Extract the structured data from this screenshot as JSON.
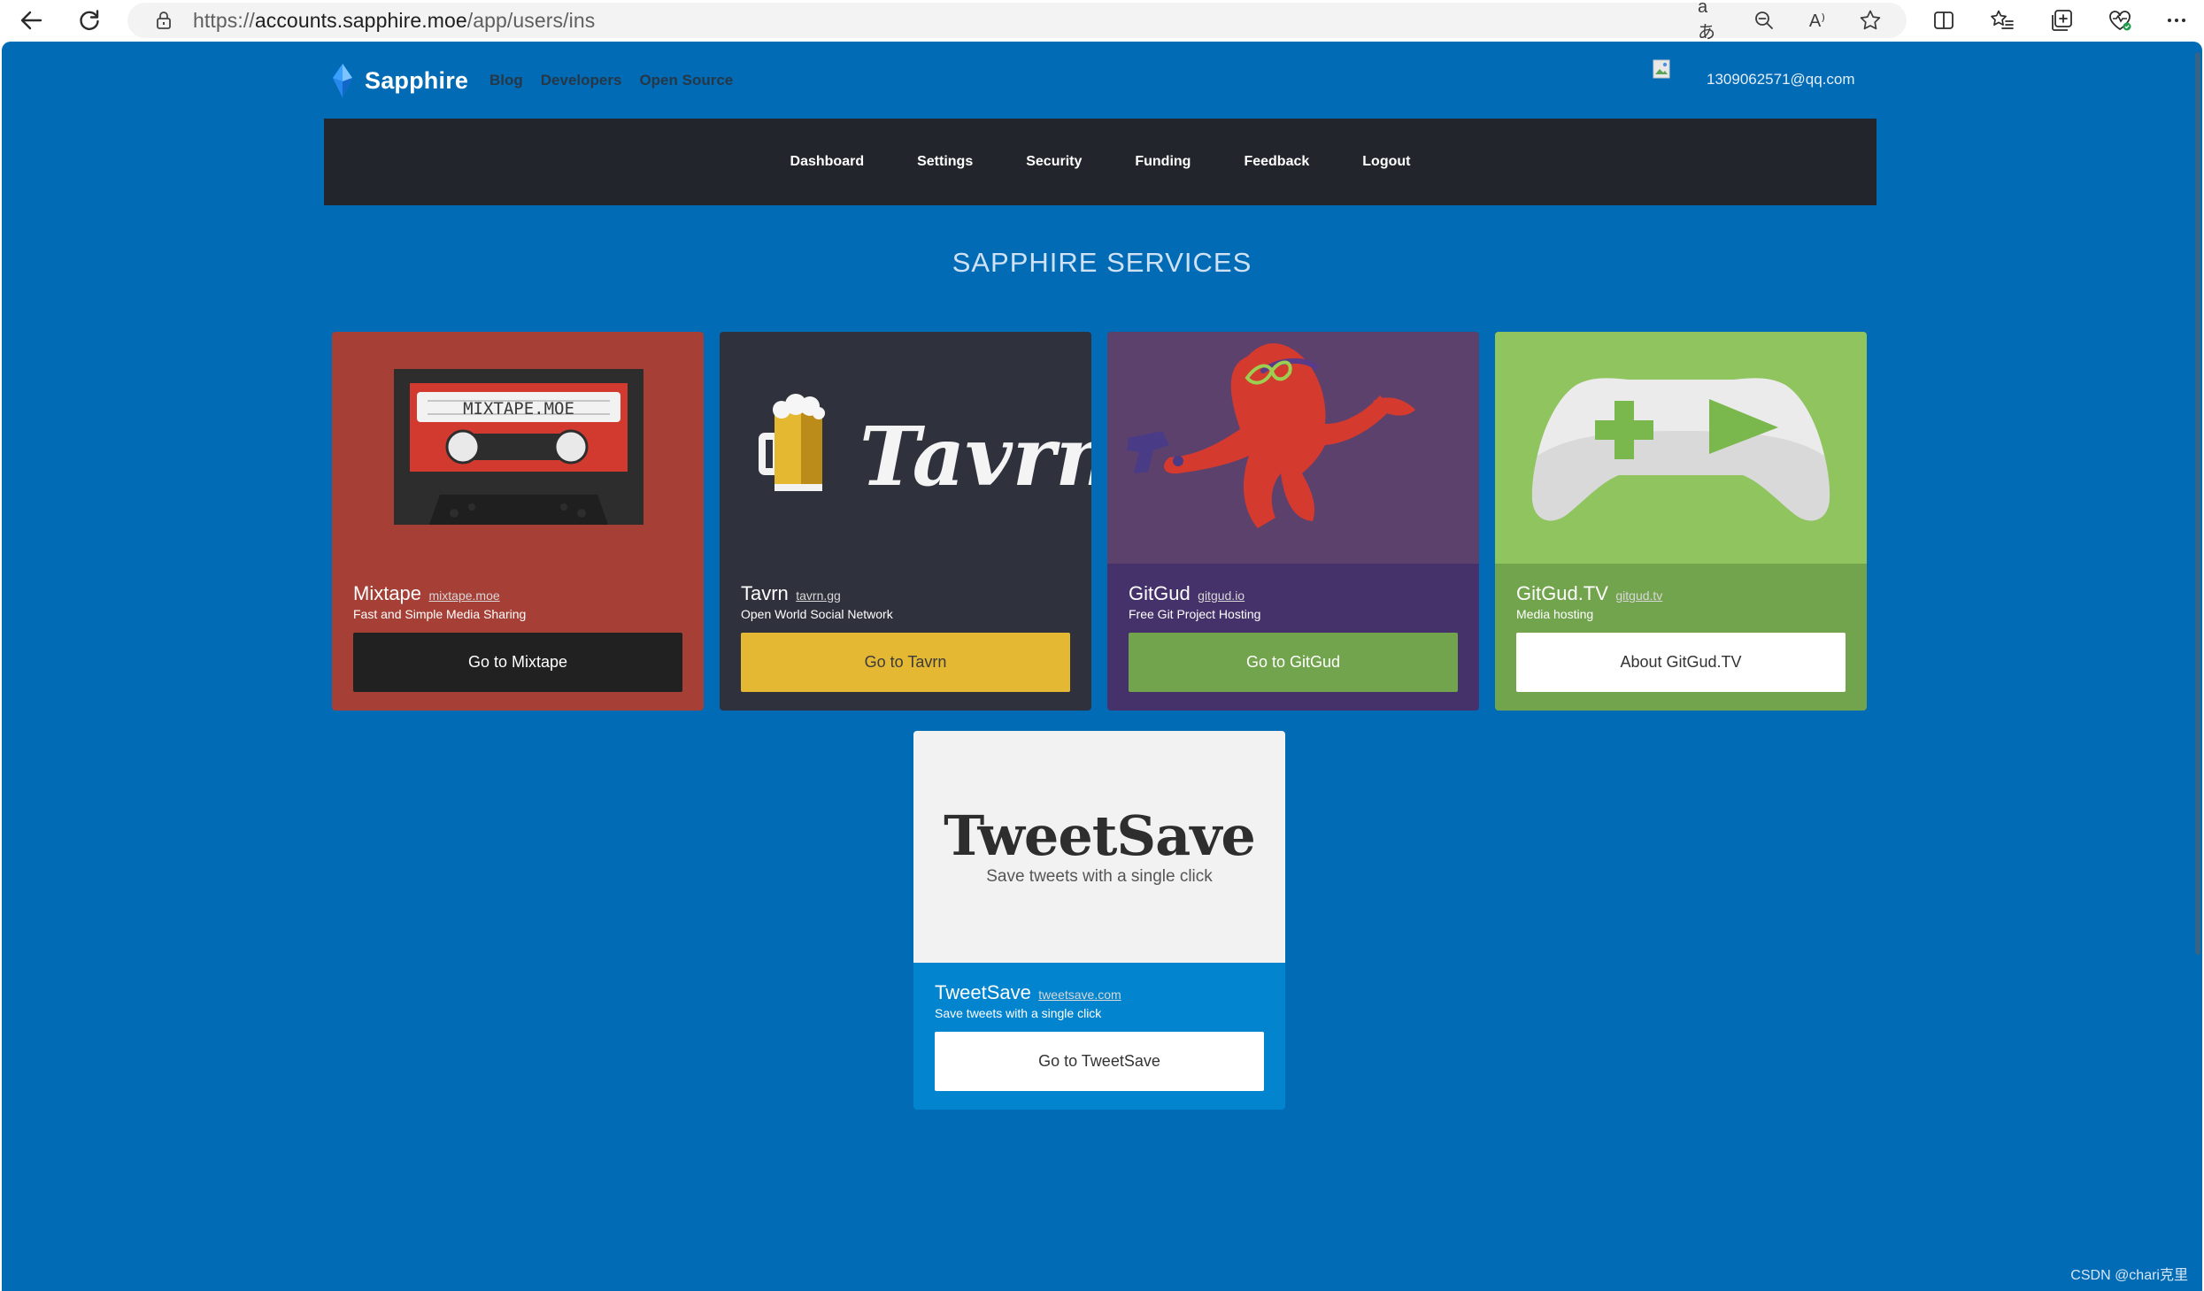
{
  "browser": {
    "url_scheme": "https://",
    "url_host": "accounts.sapphire.moe",
    "url_path": "/app/users/ins",
    "reader_icon": "aあ",
    "read_aloud_icon": "A⁾"
  },
  "site": {
    "brand_name": "Sapphire",
    "top_links": [
      "Blog",
      "Developers",
      "Open Source"
    ],
    "user_email": "1309062571@qq.com"
  },
  "dashboard_nav": [
    "Dashboard",
    "Settings",
    "Security",
    "Funding",
    "Feedback",
    "Logout"
  ],
  "section_title": "SAPPHIRE SERVICES",
  "services": [
    {
      "name": "Mixtape",
      "domain": "mixtape.moe",
      "description": "Fast and Simple Media Sharing",
      "button": "Go to Mixtape",
      "art_text": "MIXTAPE.MOE",
      "colors": {
        "card": "#a63f35",
        "button": "#212121",
        "button_text": "#ffffff"
      }
    },
    {
      "name": "Tavrn",
      "domain": "tavrn.gg",
      "description": "Open World Social Network",
      "button": "Go to Tavrn",
      "art_text": "Tavrn",
      "colors": {
        "card": "#2f323d",
        "button": "#e5b833",
        "button_text": "#3b3b3b"
      }
    },
    {
      "name": "GitGud",
      "domain": "gitgud.io",
      "description": "Free Git Project Hosting",
      "button": "Go to GitGud",
      "colors": {
        "card": "#46326a",
        "button": "#72a44e",
        "button_text": "#ffffff"
      }
    },
    {
      "name": "GitGud.TV",
      "domain": "gitgud.tv",
      "description": "Media hosting",
      "button": "About GitGud.TV",
      "colors": {
        "card": "#72a44e",
        "button": "#ffffff",
        "button_text": "#333333"
      }
    },
    {
      "name": "TweetSave",
      "domain": "tweetsave.com",
      "description": "Save tweets with a single click",
      "button": "Go to TweetSave",
      "art_text": "TweetSave",
      "art_subtext": "Save tweets with a single click",
      "colors": {
        "card": "#0284ce",
        "button": "#ffffff",
        "button_text": "#333333"
      }
    }
  ],
  "watermark": "CSDN @chari克里"
}
